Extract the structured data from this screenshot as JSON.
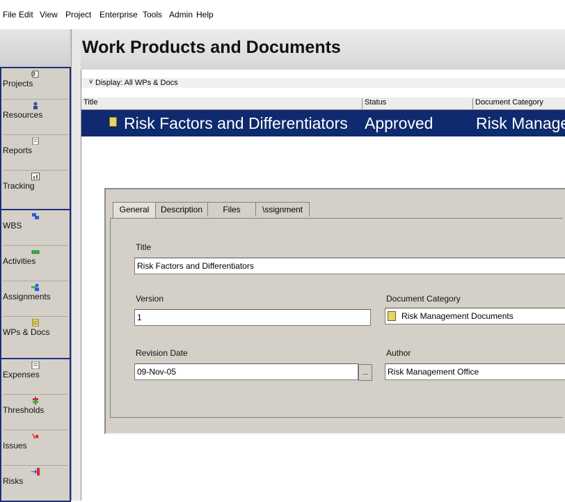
{
  "menu": [
    "File",
    "Edit",
    "View",
    "Project",
    "Enterprise",
    "Tools",
    "Admin",
    "Help"
  ],
  "header": {
    "title": "Work Products and Documents"
  },
  "sidebar": {
    "items": [
      {
        "label": "Projects",
        "icon": "projects-icon"
      },
      {
        "label": "Resources",
        "icon": "resources-icon"
      },
      {
        "label": "Reports",
        "icon": "reports-icon"
      },
      {
        "label": "Tracking",
        "icon": "tracking-icon"
      },
      {
        "label": "WBS",
        "icon": "wbs-icon"
      },
      {
        "label": "Activities",
        "icon": "activities-icon"
      },
      {
        "label": "Assignments",
        "icon": "assignments-icon"
      },
      {
        "label": "WPs & Docs",
        "icon": "document-icon"
      },
      {
        "label": "Expenses",
        "icon": "expenses-icon"
      },
      {
        "label": "Thresholds",
        "icon": "thresholds-icon"
      },
      {
        "label": "Issues",
        "icon": "issues-icon"
      },
      {
        "label": "Risks",
        "icon": "risks-icon"
      }
    ]
  },
  "list": {
    "display_label": "Display: All WPs & Docs",
    "columns": [
      "Title",
      "Status",
      "Document Category"
    ],
    "selected_row": {
      "title": "Risk Factors and Differentiators",
      "status": "Approved",
      "category": "Risk Management Documents"
    }
  },
  "detail": {
    "tabs": [
      "General",
      "Description",
      "Files",
      "\\ssignment"
    ],
    "title_label": "Title",
    "title_value": "Risk Factors and Differentiators",
    "version_label": "Version",
    "version_value": "1",
    "category_label": "Document Category",
    "category_value": "Risk Management Documents",
    "revision_label": "Revision Date",
    "revision_value": "09-Nov-05",
    "author_label": "Author",
    "author_value": "Risk Management Office",
    "browse_label": "..."
  }
}
